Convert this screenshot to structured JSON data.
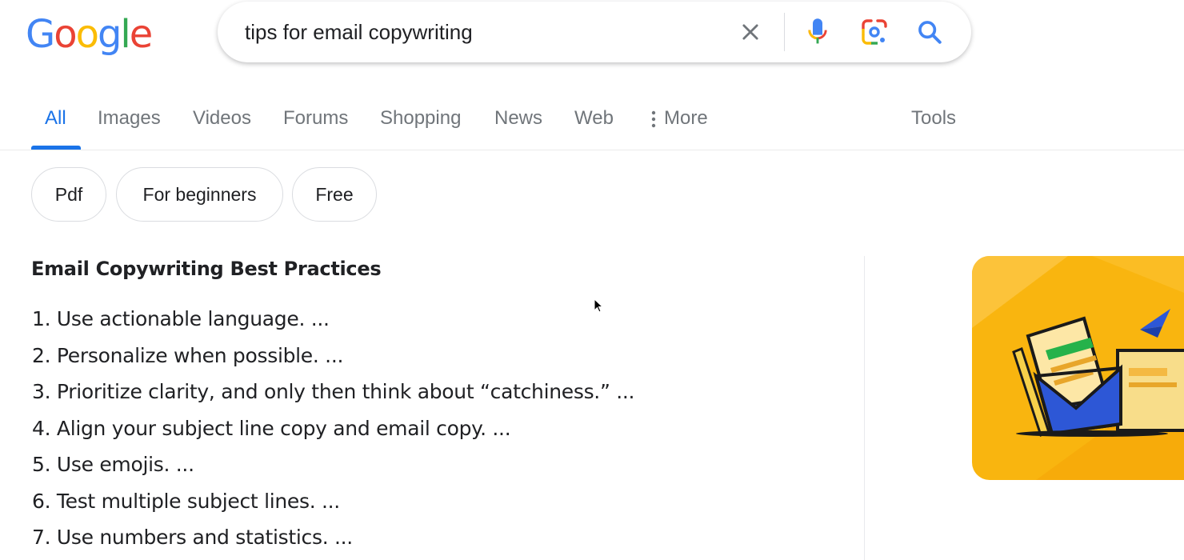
{
  "logo": {
    "letters": [
      "G",
      "o",
      "o",
      "g",
      "l",
      "e"
    ],
    "colors": [
      "#4285f4",
      "#ea4335",
      "#fbbc05",
      "#4285f4",
      "#34a853",
      "#ea4335"
    ]
  },
  "search": {
    "query": "tips for email copywriting",
    "icons": [
      "close-icon",
      "microphone-icon",
      "google-lens-icon",
      "search-icon"
    ]
  },
  "tabs": [
    {
      "label": "All",
      "active": true
    },
    {
      "label": "Images"
    },
    {
      "label": "Videos"
    },
    {
      "label": "Forums"
    },
    {
      "label": "Shopping"
    },
    {
      "label": "News"
    },
    {
      "label": "Web"
    },
    {
      "label": "More",
      "icon": "vertical-dots-icon"
    }
  ],
  "tools_label": "Tools",
  "chips": [
    "Pdf",
    "For beginners",
    "Free"
  ],
  "featured_snippet": {
    "title": "Email Copywriting Best Practices",
    "items": [
      "1. Use actionable language. ...",
      "2. Personalize when possible. ...",
      "3. Prioritize clarity, and only then think about “catchiness.” ...",
      "4. Align your subject line copy and email copy. ...",
      "5. Use emojis. ...",
      "6. Test multiple subject lines. ...",
      "7. Use numbers and statistics. ..."
    ]
  },
  "thumbnail": {
    "icon": "email-envelope-illustration",
    "background": "#f9b50f"
  },
  "colors": {
    "accent": "#1a73e8",
    "tab_inactive": "#70757a",
    "text": "#202124"
  }
}
